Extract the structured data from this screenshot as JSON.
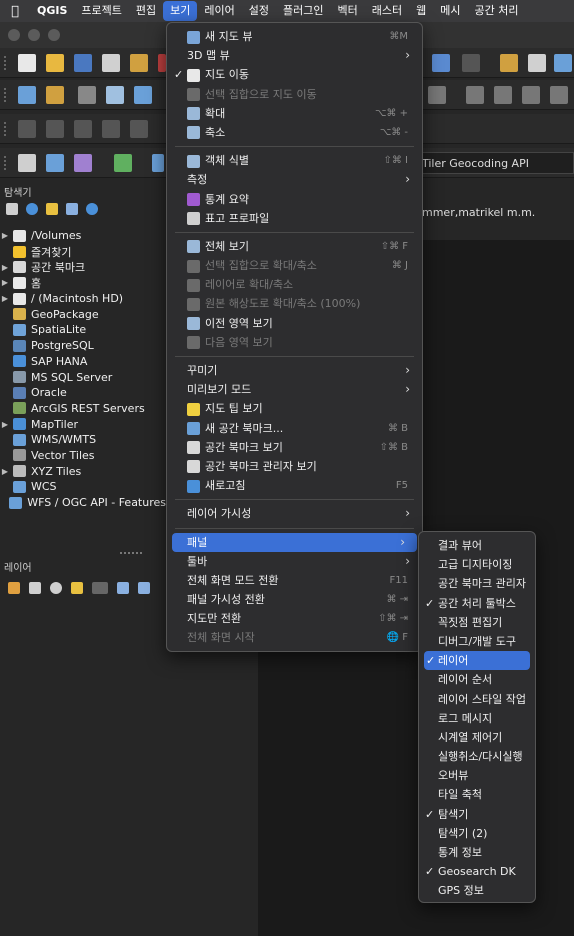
{
  "menubar": {
    "apple": "",
    "items": [
      {
        "label": "QGIS",
        "bold": true
      },
      {
        "label": "프로젝트"
      },
      {
        "label": "편집"
      },
      {
        "label": "보기",
        "active": true
      },
      {
        "label": "레이어"
      },
      {
        "label": "설정"
      },
      {
        "label": "플러그인"
      },
      {
        "label": "벡터"
      },
      {
        "label": "래스터"
      },
      {
        "label": "웹"
      },
      {
        "label": "메시"
      },
      {
        "label": "공간 처리"
      }
    ]
  },
  "background": {
    "browser_title": "탐색기",
    "layers_title": "레이어",
    "search_text": "pTiler Geocoding API",
    "mid_text": "mmer,matrikel m.m."
  },
  "browser_items": [
    {
      "label": "/Volumes",
      "arrow": "▶",
      "color": "#e8e8e8"
    },
    {
      "label": "즐겨찾기",
      "arrow": "",
      "color": "#f2c12e"
    },
    {
      "label": "공간 북마크",
      "arrow": "▶",
      "color": "#d8d8d8"
    },
    {
      "label": "홈",
      "arrow": "▶",
      "color": "#e8e8e8"
    },
    {
      "label": "/ (Macintosh HD)",
      "arrow": "▶",
      "color": "#e8e8e8"
    },
    {
      "label": "GeoPackage",
      "arrow": "",
      "color": "#d9b24c"
    },
    {
      "label": "SpatiaLite",
      "arrow": "",
      "color": "#6fa3d8"
    },
    {
      "label": "PostgreSQL",
      "arrow": "",
      "color": "#5a86b8"
    },
    {
      "label": "SAP HANA",
      "arrow": "",
      "color": "#4a90d9"
    },
    {
      "label": "MS SQL Server",
      "arrow": "",
      "color": "#8899aa"
    },
    {
      "label": "Oracle",
      "arrow": "",
      "color": "#5a7fb5"
    },
    {
      "label": "ArcGIS REST Servers",
      "arrow": "",
      "color": "#7aa05a"
    },
    {
      "label": "MapTiler",
      "arrow": "▶",
      "color": "#4a8fd6"
    },
    {
      "label": "WMS/WMTS",
      "arrow": "",
      "color": "#6aa0d8"
    },
    {
      "label": "Vector Tiles",
      "arrow": "",
      "color": "#999999"
    },
    {
      "label": "XYZ Tiles",
      "arrow": "▶",
      "color": "#bbbbbb"
    },
    {
      "label": "WCS",
      "arrow": "",
      "color": "#6aa0d8"
    },
    {
      "label": "WFS / OGC API - Features",
      "arrow": "",
      "color": "#6aa0d8"
    }
  ],
  "view_menu": [
    {
      "type": "item",
      "label": "새 지도 뷰",
      "shortcut": "⌘M",
      "icon": "#7aa5d8"
    },
    {
      "type": "item",
      "label": "3D 맵 뷰",
      "submenu": true
    },
    {
      "type": "item",
      "label": "지도 이동",
      "check": "✓",
      "icon": "#e8e8e8"
    },
    {
      "type": "item",
      "label": "선택 집합으로 지도 이동",
      "disabled": true,
      "icon": "#6a6a6a"
    },
    {
      "type": "item",
      "label": "확대",
      "shortcut": "⌥⌘ +",
      "icon": "#9ab8d8"
    },
    {
      "type": "item",
      "label": "축소",
      "shortcut": "⌥⌘ -",
      "icon": "#9ab8d8"
    },
    {
      "type": "sep"
    },
    {
      "type": "item",
      "label": "객체 식별",
      "shortcut": "⇧⌘ I",
      "icon": "#9ab8d8"
    },
    {
      "type": "item",
      "label": "측정",
      "submenu": true
    },
    {
      "type": "item",
      "label": "통계 요약",
      "icon": "#a05ad0"
    },
    {
      "type": "item",
      "label": "표고 프로파일",
      "icon": "#cfcfcf"
    },
    {
      "type": "sep"
    },
    {
      "type": "item",
      "label": "전체 보기",
      "shortcut": "⇧⌘ F",
      "icon": "#9ab8d8"
    },
    {
      "type": "item",
      "label": "선택 집합으로 확대/축소",
      "shortcut": "⌘ J",
      "disabled": true,
      "icon": "#6a6a6a"
    },
    {
      "type": "item",
      "label": "레이어로 확대/축소",
      "disabled": true,
      "icon": "#6a6a6a"
    },
    {
      "type": "item",
      "label": "원본 해상도로 확대/축소 (100%)",
      "disabled": true,
      "icon": "#6a6a6a"
    },
    {
      "type": "item",
      "label": "이전 영역 보기",
      "icon": "#9ab8d8"
    },
    {
      "type": "item",
      "label": "다음 영역 보기",
      "disabled": true,
      "icon": "#6a6a6a"
    },
    {
      "type": "sep"
    },
    {
      "type": "item",
      "label": "꾸미기",
      "submenu": true
    },
    {
      "type": "item",
      "label": "미리보기 모드",
      "submenu": true
    },
    {
      "type": "item",
      "label": "지도 팁 보기",
      "icon": "#f0d040"
    },
    {
      "type": "item",
      "label": "새 공간 북마크...",
      "shortcut": "⌘ B",
      "icon": "#6aa0d8"
    },
    {
      "type": "item",
      "label": "공간 북마크 보기",
      "shortcut": "⇧⌘ B",
      "icon": "#d8d8d8"
    },
    {
      "type": "item",
      "label": "공간 북마크 관리자 보기",
      "icon": "#d8d8d8"
    },
    {
      "type": "item",
      "label": "새로고침",
      "shortcut": "F5",
      "icon": "#4a90d9"
    },
    {
      "type": "sep"
    },
    {
      "type": "item",
      "label": "레이어 가시성",
      "submenu": true
    },
    {
      "type": "sep"
    },
    {
      "type": "item",
      "label": "패널",
      "submenu": true,
      "open": true
    },
    {
      "type": "item",
      "label": "툴바",
      "submenu": true
    },
    {
      "type": "item",
      "label": "전체 화면 모드 전환",
      "shortcut": "F11"
    },
    {
      "type": "item",
      "label": "패널 가시성 전환",
      "shortcut": "⌘ ⇥"
    },
    {
      "type": "item",
      "label": "지도만 전환",
      "shortcut": "⇧⌘ ⇥"
    },
    {
      "type": "item",
      "label": "전체 화면 시작",
      "shortcut": "🌐 F",
      "disabled": true
    }
  ],
  "panels_menu": [
    {
      "label": "결과 뷰어",
      "checked": false
    },
    {
      "label": "고급 디지타이징",
      "checked": false
    },
    {
      "label": "공간 북마크 관리자",
      "checked": false
    },
    {
      "label": "공간 처리 툴박스",
      "checked": true
    },
    {
      "label": "꼭짓점 편집기",
      "checked": false
    },
    {
      "label": "디버그/개발 도구",
      "checked": false
    },
    {
      "label": "레이어",
      "checked": true,
      "highlight": true
    },
    {
      "label": "레이어 순서",
      "checked": false
    },
    {
      "label": "레이어 스타일 작업",
      "checked": false
    },
    {
      "label": "로그 메시지",
      "checked": false
    },
    {
      "label": "시계열 제어기",
      "checked": false
    },
    {
      "label": "실행취소/다시실행",
      "checked": false
    },
    {
      "label": "오버뷰",
      "checked": false
    },
    {
      "label": "타일 축척",
      "checked": false
    },
    {
      "label": "탐색기",
      "checked": true
    },
    {
      "label": "탐색기 (2)",
      "checked": false
    },
    {
      "label": "통계 정보",
      "checked": false
    },
    {
      "label": "Geosearch DK",
      "checked": true
    },
    {
      "label": "GPS 정보",
      "checked": false
    }
  ],
  "check_glyph": "✓",
  "submenu_glyph": "›"
}
